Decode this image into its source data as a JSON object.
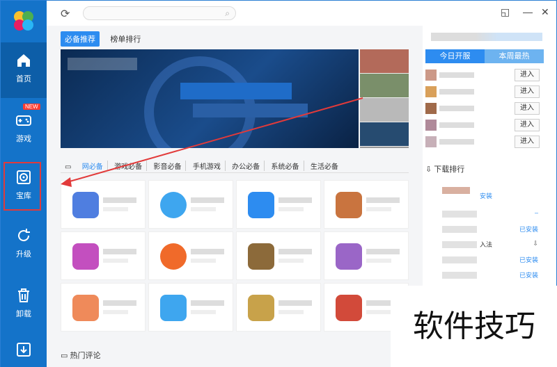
{
  "sidebar": {
    "items": [
      {
        "label": "首页",
        "icon": "home-icon",
        "active": true
      },
      {
        "label": "游戏",
        "icon": "gamepad-icon",
        "badge": "NEW"
      },
      {
        "label": "宝库",
        "icon": "disc-icon"
      },
      {
        "label": "升级",
        "icon": "upgrade-icon"
      },
      {
        "label": "卸载",
        "icon": "trash-icon"
      },
      {
        "label": "",
        "icon": "download-icon"
      }
    ]
  },
  "top_tabs": [
    "必备推荐",
    "榜单排行"
  ],
  "right_panel": {
    "tabs": [
      "今日开服",
      "本周最热"
    ],
    "enter_label": "进入",
    "download_rank": "下载排行",
    "installed": "已安装",
    "install": "安装",
    "input_method": "入法"
  },
  "categories": [
    "网必备",
    "游戏必备",
    "影音必备",
    "手机游戏",
    "办公必备",
    "系统必备",
    "生活必备"
  ],
  "hot_comments": "热门评论",
  "watermark": "软件技巧",
  "colors": {
    "accent": "#2d8cf0",
    "sidebar": "#1473c9",
    "arrow": "#e23a3a"
  }
}
